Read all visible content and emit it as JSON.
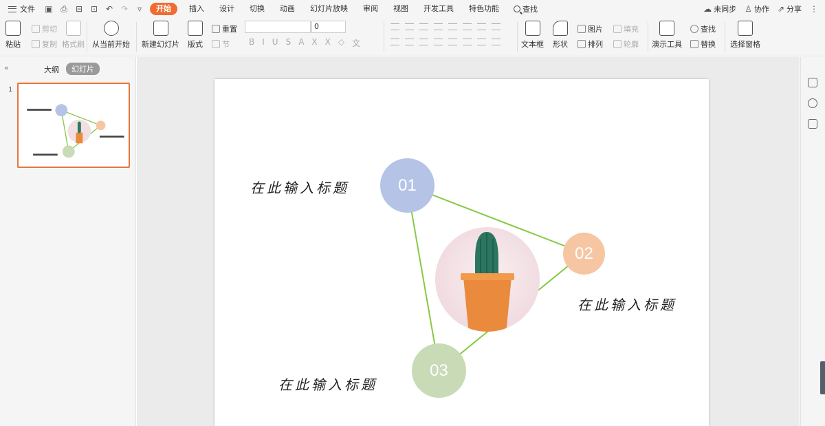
{
  "menu": {
    "file": "文件",
    "tabs": [
      "开始",
      "插入",
      "设计",
      "切换",
      "动画",
      "幻灯片放映",
      "审阅",
      "视图",
      "开发工具",
      "特色功能"
    ],
    "search": "查找",
    "right": {
      "sync": "未同步",
      "collab": "协作",
      "share": "分享"
    }
  },
  "ribbon": {
    "paste": "粘贴",
    "cut": "剪切",
    "copy": "复制",
    "format_painter": "格式刷",
    "from_current": "从当前开始",
    "new_slide": "新建幻灯片",
    "layout": "版式",
    "reset": "重置",
    "section": "节",
    "font_size": "0",
    "textbox": "文本框",
    "shape": "形状",
    "picture": "图片",
    "fill": "填充",
    "arrange": "排列",
    "outline": "轮廓",
    "present_tools": "演示工具",
    "find": "查找",
    "replace": "替换",
    "select_pane": "选择窗格"
  },
  "left_panel": {
    "outline_tab": "大纲",
    "slides_tab": "幻灯片",
    "slide_number": "1"
  },
  "slide": {
    "items": [
      {
        "number": "01",
        "title": "在此输入标题",
        "color": "#b4c3e6"
      },
      {
        "number": "02",
        "title": "在此输入标题",
        "color": "#f6c6a3"
      },
      {
        "number": "03",
        "title": "在此输入标题",
        "color": "#c9dab6"
      }
    ],
    "connector_color": "#86c942"
  }
}
